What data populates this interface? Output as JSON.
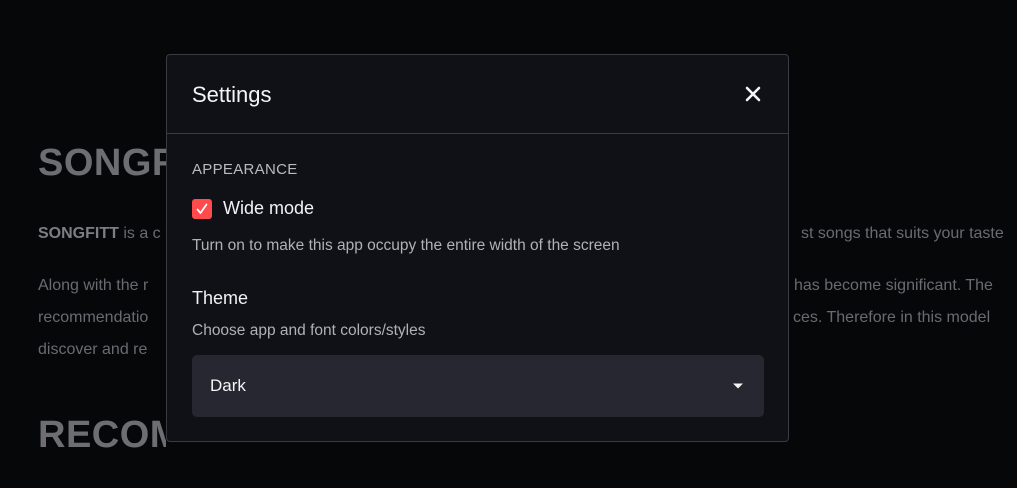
{
  "background": {
    "title": "SONGFITT",
    "title2": "RECOMMENDATION ENGINE",
    "line1_left_bold": "SONGFITT",
    "line1_left": " is a c",
    "line1_right": "st songs that suits your taste",
    "line2_left": "Along with the r",
    "line2_right": "has become significant. The",
    "line3_left": "recommendatio",
    "line3_right": "ces. Therefore in this model",
    "line4_left": "discover and re"
  },
  "modal": {
    "title": "Settings",
    "close_icon": "close-icon",
    "appearance": {
      "section_label": "APPEARANCE",
      "wide_mode": {
        "label": "Wide mode",
        "checked": true,
        "help": "Turn on to make this app occupy the entire width of the screen"
      }
    },
    "theme": {
      "label": "Theme",
      "help": "Choose app and font colors/styles",
      "selected": "Dark"
    }
  },
  "colors": {
    "accent": "#ff4b4b",
    "modal_bg": "#0f1117",
    "select_bg": "#262730"
  }
}
